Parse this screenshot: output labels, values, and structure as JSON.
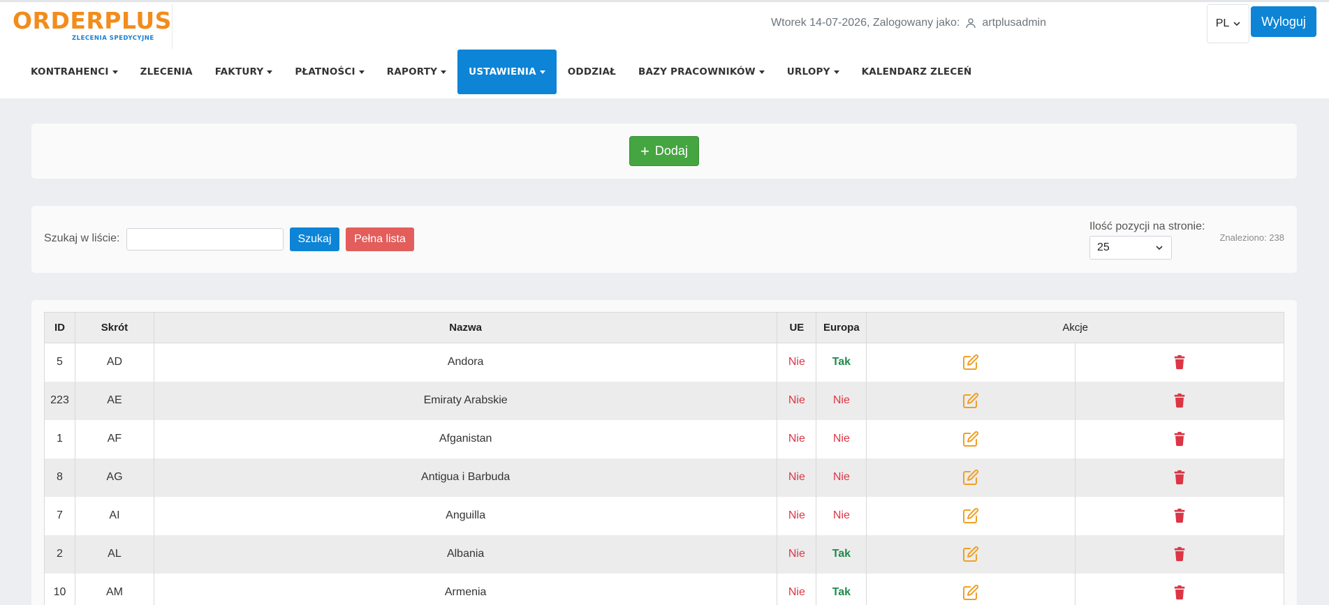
{
  "logo": {
    "main": "ORDERPLUS",
    "sub": "ZLECENIA SPEDYCYJNE"
  },
  "header": {
    "date_text": "Wtorek 14-07-2026, Zalogowany jako:",
    "username": "artplusadmin",
    "language": "PL",
    "logout_label": "Wyloguj"
  },
  "nav": [
    {
      "label": "KONTRAHENCI",
      "dropdown": true,
      "active": false
    },
    {
      "label": "ZLECENIA",
      "dropdown": false,
      "active": false
    },
    {
      "label": "FAKTURY",
      "dropdown": true,
      "active": false
    },
    {
      "label": "PŁATNOŚCI",
      "dropdown": true,
      "active": false
    },
    {
      "label": "RAPORTY",
      "dropdown": true,
      "active": false
    },
    {
      "label": "USTAWIENIA",
      "dropdown": true,
      "active": true
    },
    {
      "label": "ODDZIAŁ",
      "dropdown": false,
      "active": false
    },
    {
      "label": "BAZY PRACOWNIKÓW",
      "dropdown": true,
      "active": false
    },
    {
      "label": "URLOPY",
      "dropdown": true,
      "active": false
    },
    {
      "label": "KALENDARZ ZLECEŃ",
      "dropdown": false,
      "active": false
    }
  ],
  "add_button": {
    "label": "Dodaj"
  },
  "search": {
    "label": "Szukaj w liście:",
    "value": "",
    "search_label": "Szukaj",
    "full_list_label": "Pełna lista",
    "perpage_label": "Ilość pozycji na stronie:",
    "perpage_value": "25",
    "found_text": "Znaleziono: 238"
  },
  "table": {
    "headers": {
      "id": "ID",
      "short": "Skrót",
      "name": "Nazwa",
      "eu": "UE",
      "europe": "Europa",
      "actions": "Akcje"
    },
    "rows": [
      {
        "id": "5",
        "short": "AD",
        "name": "Andora",
        "eu": "Nie",
        "europe": "Tak"
      },
      {
        "id": "223",
        "short": "AE",
        "name": "Emiraty Arabskie",
        "eu": "Nie",
        "europe": "Nie"
      },
      {
        "id": "1",
        "short": "AF",
        "name": "Afganistan",
        "eu": "Nie",
        "europe": "Nie"
      },
      {
        "id": "8",
        "short": "AG",
        "name": "Antigua i Barbuda",
        "eu": "Nie",
        "europe": "Nie"
      },
      {
        "id": "7",
        "short": "AI",
        "name": "Anguilla",
        "eu": "Nie",
        "europe": "Nie"
      },
      {
        "id": "2",
        "short": "AL",
        "name": "Albania",
        "eu": "Nie",
        "europe": "Tak"
      },
      {
        "id": "10",
        "short": "AM",
        "name": "Armenia",
        "eu": "Nie",
        "europe": "Tak"
      }
    ]
  },
  "colors": {
    "brand_orange": "#f28c1c",
    "brand_blue": "#0d84d6",
    "success_green": "#45a541",
    "danger_red": "#dc3545",
    "edit_orange": "#f0a023"
  },
  "icons": {
    "edit": "edit-icon",
    "delete": "trash-icon",
    "user": "user-icon"
  }
}
